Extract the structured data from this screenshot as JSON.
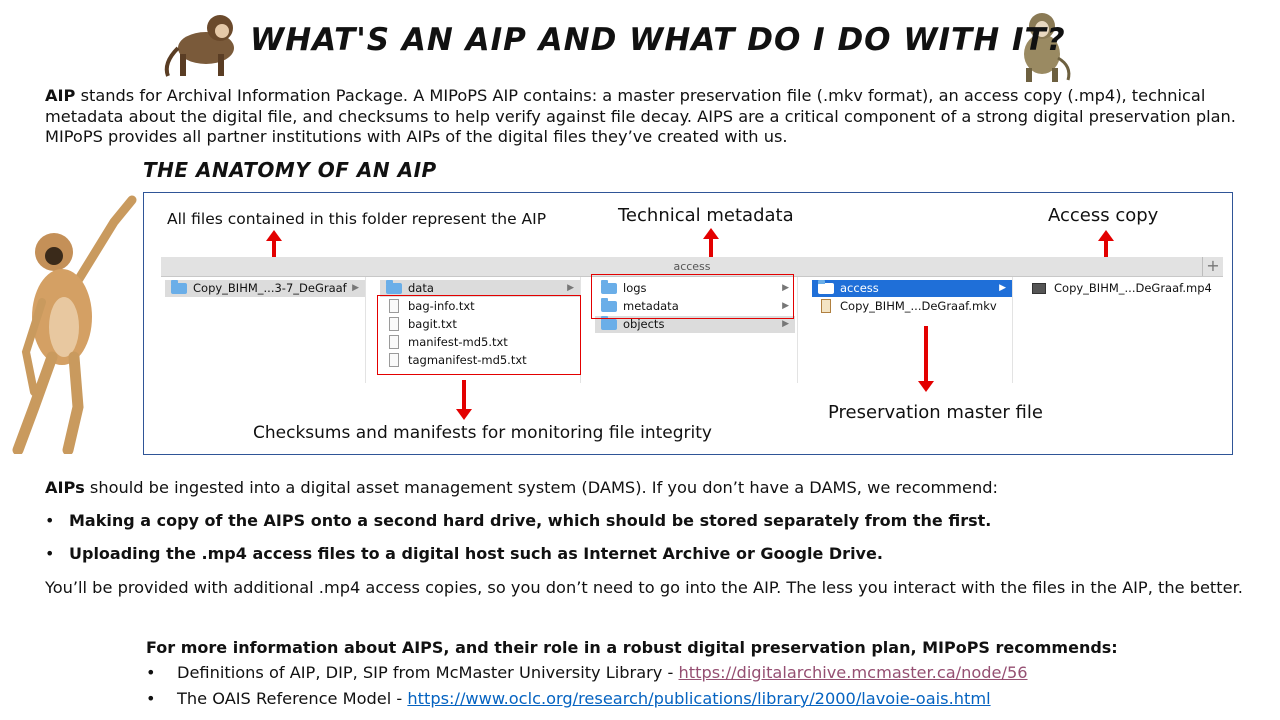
{
  "title": "WHAT'S AN AIP AND WHAT DO I DO WITH IT?",
  "intro": {
    "lead": "AIP",
    "text": " stands for Archival Information Package. A MIPoPS AIP contains: a master preservation file (.mkv format), an access copy (.mp4), technical metadata about the digital file, and checksums to help verify against file decay. AIPS are a critical component of a strong digital preservation plan. MIPoPS provides all partner institutions with AIPs of the digital files they’ve created with us."
  },
  "subheading": "THE ANATOMY OF AN AIP",
  "callouts": {
    "all_files": "All files contained in this folder represent the AIP",
    "technical_metadata": "Technical metadata",
    "access_copy": "Access copy",
    "checksums": "Checksums and manifests for monitoring file integrity",
    "preservation_master": "Preservation master file"
  },
  "finder": {
    "path_title": "access",
    "plus": "+",
    "col1": [
      {
        "name": "Copy_BIHM_...3-7_DeGraaf",
        "kind": "folder"
      }
    ],
    "col2": [
      {
        "name": "data",
        "kind": "folder"
      },
      {
        "name": "bag-info.txt",
        "kind": "file"
      },
      {
        "name": "bagit.txt",
        "kind": "file"
      },
      {
        "name": "manifest-md5.txt",
        "kind": "file"
      },
      {
        "name": "tagmanifest-md5.txt",
        "kind": "file"
      }
    ],
    "col3": [
      {
        "name": "logs",
        "kind": "folder"
      },
      {
        "name": "metadata",
        "kind": "folder"
      },
      {
        "name": "objects",
        "kind": "folder"
      }
    ],
    "col4": [
      {
        "name": "access",
        "kind": "folder"
      },
      {
        "name": "Copy_BIHM_...DeGraaf.mkv",
        "kind": "file"
      }
    ],
    "col5": [
      {
        "name": "Copy_BIHM_...DeGraaf.mp4",
        "kind": "file"
      }
    ]
  },
  "dams": {
    "lead": "AIPs",
    "text": " should be ingested into a digital asset management system (DAMS). If you don’t have a DAMS, we recommend:"
  },
  "recommendations": [
    "Making a copy of the AIPS onto a second hard drive, which should be stored separately from the first.",
    "Uploading the .mp4 access files to a digital host such as Internet Archive or Google Drive."
  ],
  "bullet_char": "•",
  "closing": "You’ll be provided with additional .mp4 access copies, so you don’t need to go into the AIP. The less you interact with the files in the AIP, the better.",
  "more_info": {
    "heading": "For more information about AIPS, and their role in a robust digital preservation plan, MIPoPS recommends:",
    "items": [
      {
        "label": "Definitions of AIP, DIP, SIP from McMaster University Library - ",
        "link": "https://digitalarchive.mcmaster.ca/node/56"
      },
      {
        "label": "The OAIS Reference Model - ",
        "link": "https://www.oclc.org/research/publications/library/2000/lavoie-oais.html"
      }
    ]
  },
  "colors": {
    "red": "#e30000",
    "finder_blue": "#1f6fd8",
    "link": "#0563c1",
    "visited_link": "#954f72",
    "panel_border": "#2f5597"
  }
}
